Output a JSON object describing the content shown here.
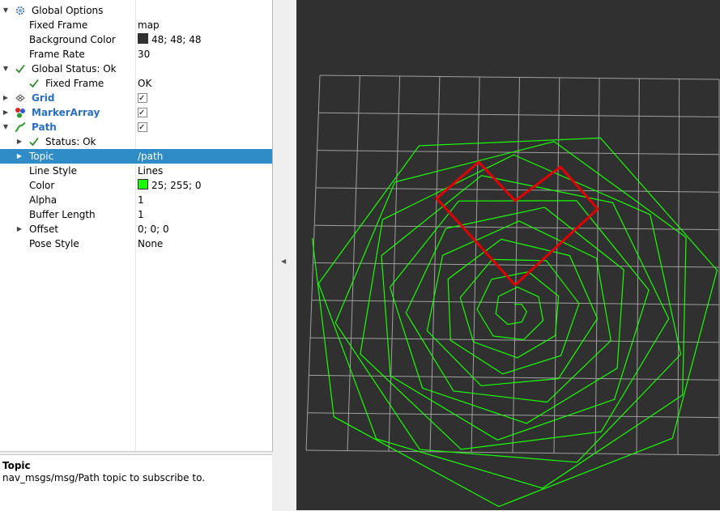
{
  "tree": {
    "rows": [
      {
        "label": "Global Options",
        "value": "",
        "indent": 0,
        "arrow": "down",
        "icon": "gear"
      },
      {
        "label": "Fixed Frame",
        "value": "map",
        "indent": 1
      },
      {
        "label": "Background Color",
        "value": "48; 48; 48",
        "indent": 1,
        "swatch": "#303030"
      },
      {
        "label": "Frame Rate",
        "value": "30",
        "indent": 1
      },
      {
        "label": "Global Status: Ok",
        "value": "",
        "indent": 0,
        "arrow": "down",
        "icon": "check"
      },
      {
        "label": "Fixed Frame",
        "value": "OK",
        "indent": 1,
        "icon": "check"
      },
      {
        "label": "Grid",
        "value": "",
        "indent": 0,
        "arrow": "right",
        "icon": "grid",
        "blue": true,
        "checkbox": true
      },
      {
        "label": "MarkerArray",
        "value": "",
        "indent": 0,
        "arrow": "right",
        "icon": "markers",
        "blue": true,
        "checkbox": true
      },
      {
        "label": "Path",
        "value": "",
        "indent": 0,
        "arrow": "down",
        "icon": "path",
        "blue": true,
        "checkbox": true
      },
      {
        "label": "Status: Ok",
        "value": "",
        "indent": 1,
        "arrow": "right",
        "icon": "check"
      },
      {
        "label": "Topic",
        "value": "/path",
        "indent": 1,
        "arrow": "right",
        "selected": true
      },
      {
        "label": "Line Style",
        "value": "Lines",
        "indent": 1
      },
      {
        "label": "Color",
        "value": "25; 255; 0",
        "indent": 1,
        "swatch": "#19ff00"
      },
      {
        "label": "Alpha",
        "value": "1",
        "indent": 1
      },
      {
        "label": "Buffer Length",
        "value": "1",
        "indent": 1
      },
      {
        "label": "Offset",
        "value": "0; 0; 0",
        "indent": 1,
        "arrow": "right"
      },
      {
        "label": "Pose Style",
        "value": "None",
        "indent": 1
      }
    ]
  },
  "description": {
    "title": "Topic",
    "text": "nav_msgs/msg/Path topic to subscribe to."
  },
  "viewport": {
    "background": "#303030",
    "grid_color": "#a0a0a0",
    "path_color": "#19ff00",
    "marker_color": "#e00000"
  }
}
